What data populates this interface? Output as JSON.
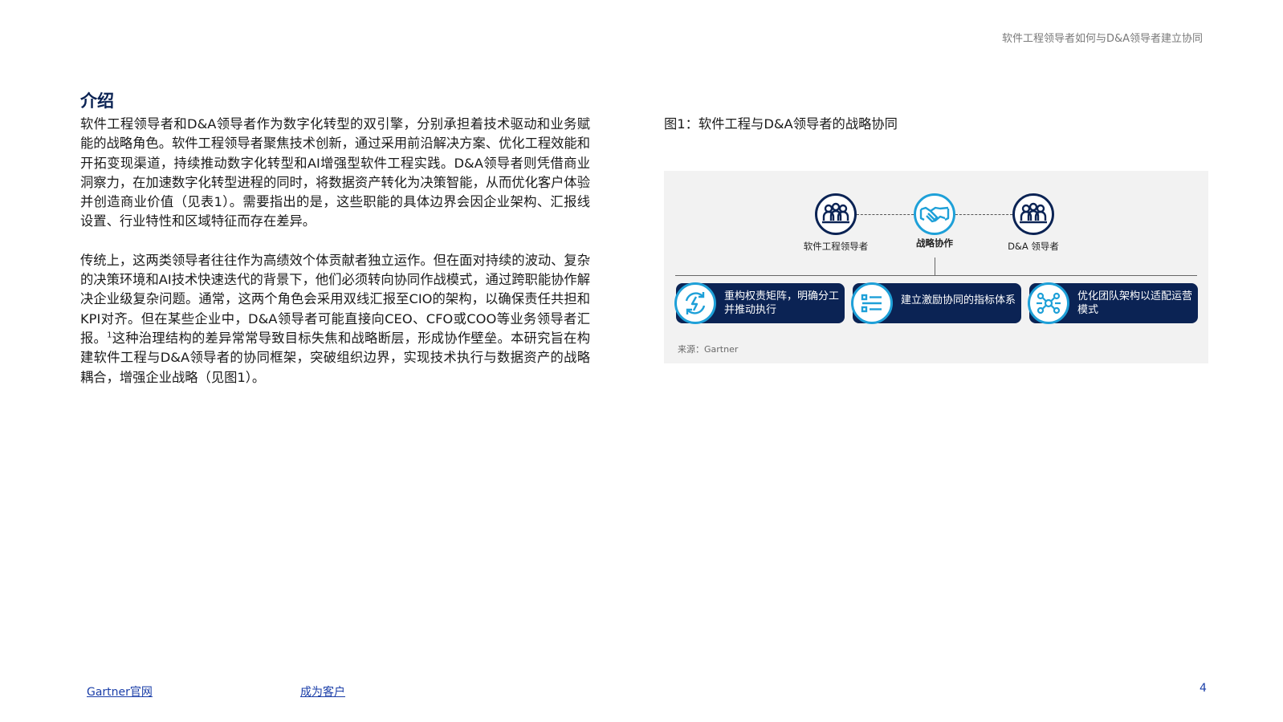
{
  "header": {
    "title": "软件工程领导者如何与D&A领导者建立协同"
  },
  "section": {
    "title": "介绍"
  },
  "body": {
    "p1": "软件工程领导者和D&A领导者作为数字化转型的双引擎，分别承担着技术驱动和业务赋能的战略角色。软件工程领导者聚焦技术创新，通过采用前沿解决方案、优化工程效能和开拓变现渠道，持续推动数字化转型和AI增强型软件工程实践。D&A领导者则凭借商业洞察力，在加速数字化转型进程的同时，将数据资产转化为决策智能，从而优化客户体验并创造商业价值（见表1）。需要指出的是，这些职能的具体边界会因企业架构、汇报线设置、行业特性和区域特征而存在差异。",
    "p2_part1": "传统上，这两类领导者往往作为高绩效个体贡献者独立运作。但在面对持续的波动、复杂的决策环境和AI技术快速迭代的背景下，他们必须转向协同作战模式，通过跨职能协作解决企业级复杂问题。通常，这两个角色会采用双线汇报至CIO的架构，以确保责任共担和KPI对齐。但在某些企业中，D&A领导者可能直接向CEO、CFO或COO等业务领导者汇报。",
    "p2_sup": "1",
    "p2_part2": "这种治理结构的差异常常导致目标失焦和战略断层，形成协作壁垒。本研究旨在构建软件工程与D&A领导者的协同框架，突破组织边界，实现技术执行与数据资产的战略耦合，增强企业战略（见图1）。"
  },
  "figure": {
    "caption": "图1：软件工程与D&A领导者的战略协同",
    "nodes": {
      "left": {
        "label": "软件工程领导者",
        "icon": "people-group-icon"
      },
      "center": {
        "label": "战略协作",
        "icon": "handshake-icon"
      },
      "right": {
        "label": "D&A 领导者",
        "icon": "people-group-icon"
      }
    },
    "cards": [
      {
        "text": "重构权责矩阵，明确分工并推动执行",
        "icon": "refresh-lightning-icon"
      },
      {
        "text": "建立激励协同的指标体系",
        "icon": "checklist-icon"
      },
      {
        "text": "优化团队架构以适配运营模式",
        "icon": "network-team-icon"
      }
    ],
    "source": "来源：Gartner",
    "colors": {
      "navy": "#0b2354",
      "accent": "#1ea0d8",
      "panel": "#f2f2f2"
    }
  },
  "footer": {
    "link1": "Gartner官网",
    "link2": "成为客户",
    "page_number": "4"
  }
}
